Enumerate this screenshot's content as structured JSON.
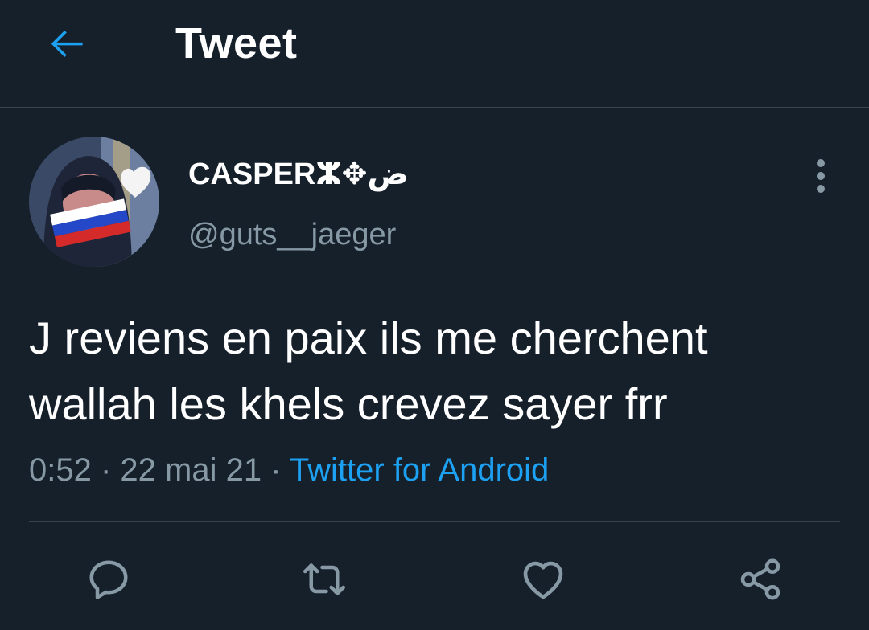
{
  "header": {
    "title": "Tweet",
    "back_icon": "arrow-left-icon"
  },
  "colors": {
    "background": "#15202b",
    "accent": "#1da1f2",
    "secondary_text": "#8899a6",
    "border": "#38444d"
  },
  "tweet": {
    "display_name": "CASPERⵣ✥ض",
    "handle": "@guts__jaeger",
    "text": "J reviens en paix ils me cherchent\nwallah les khels crevez sayer frr",
    "time": "0:52",
    "separator": " · ",
    "date": "22 mai 21",
    "source": "Twitter for Android"
  },
  "actions": [
    {
      "name": "reply",
      "icon": "reply-icon"
    },
    {
      "name": "retweet",
      "icon": "retweet-icon"
    },
    {
      "name": "like",
      "icon": "heart-icon"
    },
    {
      "name": "share",
      "icon": "share-icon"
    }
  ]
}
